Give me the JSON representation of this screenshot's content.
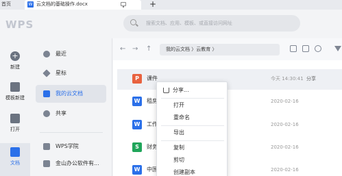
{
  "tabs": {
    "home_label": "首页",
    "doc_label": "云文档的基础操作.docx",
    "doc_icon": "W"
  },
  "header": {
    "logo": "WPS",
    "search_placeholder": "搜索文档、应用、模板、或直接访问网址"
  },
  "rail": {
    "items": [
      {
        "label": "新建",
        "icon": "plus-circle-icon"
      },
      {
        "label": "模板新建",
        "icon": "template-icon"
      },
      {
        "label": "打开",
        "icon": "folder-icon"
      },
      {
        "label": "文档",
        "icon": "document-icon"
      }
    ]
  },
  "nav": {
    "items": [
      {
        "label": "最近",
        "icon": "clock-icon"
      },
      {
        "label": "星标",
        "icon": "star-icon"
      },
      {
        "label": "我的云文档",
        "icon": "cloud-icon"
      },
      {
        "label": "共享",
        "icon": "people-icon"
      },
      {
        "label": "WPS学院",
        "icon": "academy-icon"
      },
      {
        "label": "金山办公软件有...",
        "icon": "company-icon"
      }
    ]
  },
  "toolbar": {
    "back": "←",
    "forward": "→",
    "up": "↑",
    "breadcrumb": "我的云文档 〉云教育 〉"
  },
  "files": [
    {
      "icon": "P",
      "color": "#e8623f",
      "name": "课件",
      "date": "今天 14:30:41",
      "share": "分享"
    },
    {
      "icon": "W",
      "color": "#2b70e9",
      "name": "租房",
      "date": "2020-02-16",
      "share": ""
    },
    {
      "icon": "W",
      "color": "#2b70e9",
      "name": "工作",
      "date": "2020-02-16",
      "share": ""
    },
    {
      "icon": "S",
      "color": "#1fa55a",
      "name": "财务",
      "date": "2020-02-16",
      "share": ""
    },
    {
      "icon": "W",
      "color": "#2b70e9",
      "name": "中国",
      "date": "2020-02-16",
      "share": ""
    }
  ],
  "context_menu": {
    "items": [
      "分享...",
      "打开",
      "重命名",
      "导出",
      "复制",
      "剪切",
      "创建副本"
    ]
  },
  "colors": {
    "accent": "#2b70e9",
    "ppt": "#e8623f",
    "sheet": "#1fa55a"
  }
}
